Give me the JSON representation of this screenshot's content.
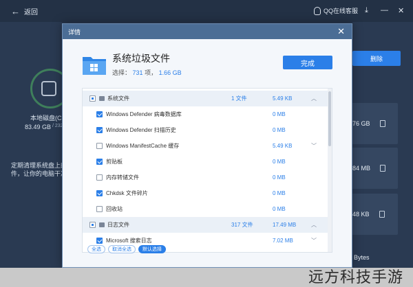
{
  "topbar": {
    "back_label": "返回",
    "qq_label": "QQ在线客服"
  },
  "sidebar": {
    "disk_label": "本地磁盘(C",
    "disk_size": "83.49 GB",
    "disk_total": "/ 232.",
    "tip_line1": "定期清理系统盘上的",
    "tip_line2": "件，让你的电脑干净"
  },
  "right": {
    "delete_label": "删除",
    "sizes": [
      "76 GB",
      "84 MB",
      "48 KB"
    ],
    "bytes": "Bytes"
  },
  "dialog": {
    "title": "详情",
    "heading": "系统垃圾文件",
    "select_prefix": "选择：",
    "select_count": "731",
    "select_sep": "项，",
    "select_size": "1.66 GB",
    "done_label": "完成",
    "rows": [
      {
        "type": "group",
        "checked": "part",
        "label": "系统文件",
        "count": "1 文件",
        "size": "5.49 KB",
        "chevron": "^"
      },
      {
        "type": "child",
        "checked": "on",
        "label": "Windows Defender 病毒数据库",
        "size": "0 MB"
      },
      {
        "type": "child",
        "checked": "on",
        "label": "Windows Defender 扫描历史",
        "size": "0 MB"
      },
      {
        "type": "child",
        "checked": "off",
        "label": "Windows ManifestCache 缓存",
        "size": "5.49 KB",
        "chevron": "v"
      },
      {
        "type": "child",
        "checked": "on",
        "label": "剪贴板",
        "size": "0 MB"
      },
      {
        "type": "child",
        "checked": "off",
        "label": "内存转储文件",
        "size": "0 MB"
      },
      {
        "type": "child",
        "checked": "on",
        "label": "Chkdsk 文件碎片",
        "size": "0 MB"
      },
      {
        "type": "child",
        "checked": "off",
        "label": "回收站",
        "size": "0 MB"
      },
      {
        "type": "group",
        "checked": "part",
        "label": "日志文件",
        "count": "317 文件",
        "size": "17.49 MB",
        "chevron": "^"
      },
      {
        "type": "child",
        "checked": "on",
        "label": "Microsoft 搜索日志",
        "size": "7.02 MB",
        "chevron": "v"
      }
    ],
    "filters": [
      "全选",
      "取消全选",
      "默认选择"
    ]
  },
  "watermark": "远方科技手游",
  "colors": {
    "accent": "#2b7fe8",
    "title_bar": "#4b6d95",
    "bg": "#27364d"
  }
}
